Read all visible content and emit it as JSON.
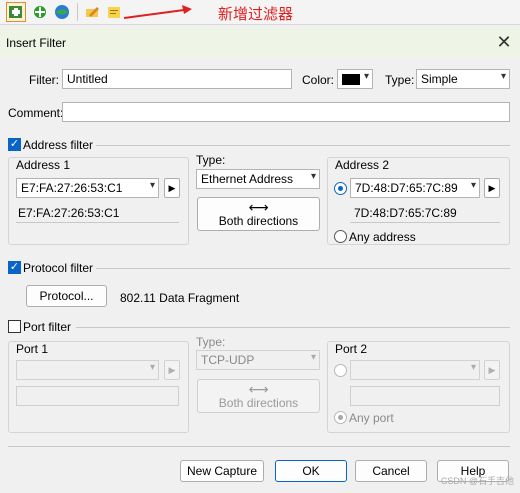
{
  "colors": {
    "accent": "#0a64c8",
    "annotation": "#e02020",
    "titlebar_bg": "#eef4e6"
  },
  "toolbar": {
    "buttons": [
      "new-filter-icon",
      "add-filter-icon",
      "globe-filter-icon",
      "edit-filter-icon",
      "edit-note-icon"
    ],
    "annotation": "新增过滤器"
  },
  "dialog": {
    "title": "Insert Filter",
    "filter_label": "Filter:",
    "filter_value": "Untitled",
    "color_label": "Color:",
    "color_value": "#000000",
    "type_label": "Type:",
    "type_value": "Simple",
    "comment_label": "Comment:",
    "comment_value": ""
  },
  "address_filter": {
    "label": "Address filter",
    "checked": true,
    "address1": {
      "title": "Address 1",
      "value": "E7:FA:27:26:53:C1",
      "resolved": "E7:FA:27:26:53:C1"
    },
    "type_label": "Type:",
    "type_value": "Ethernet Address",
    "direction_label": "Both directions",
    "address2": {
      "title": "Address 2",
      "value": "7D:48:D7:65:7C:89",
      "resolved": "7D:48:D7:65:7C:89",
      "any_label": "Any address"
    }
  },
  "protocol_filter": {
    "label": "Protocol filter",
    "checked": true,
    "button_label": "Protocol...",
    "value": "802.11 Data Fragment"
  },
  "port_filter": {
    "label": "Port filter",
    "checked": false,
    "port1_title": "Port 1",
    "type_label": "Type:",
    "type_value": "TCP-UDP",
    "direction_label": "Both directions",
    "port2_title": "Port 2",
    "any_label": "Any port"
  },
  "footer": {
    "new_capture": "New Capture",
    "ok": "OK",
    "cancel": "Cancel",
    "help": "Help"
  },
  "watermark": "CSDN @石手吉他"
}
